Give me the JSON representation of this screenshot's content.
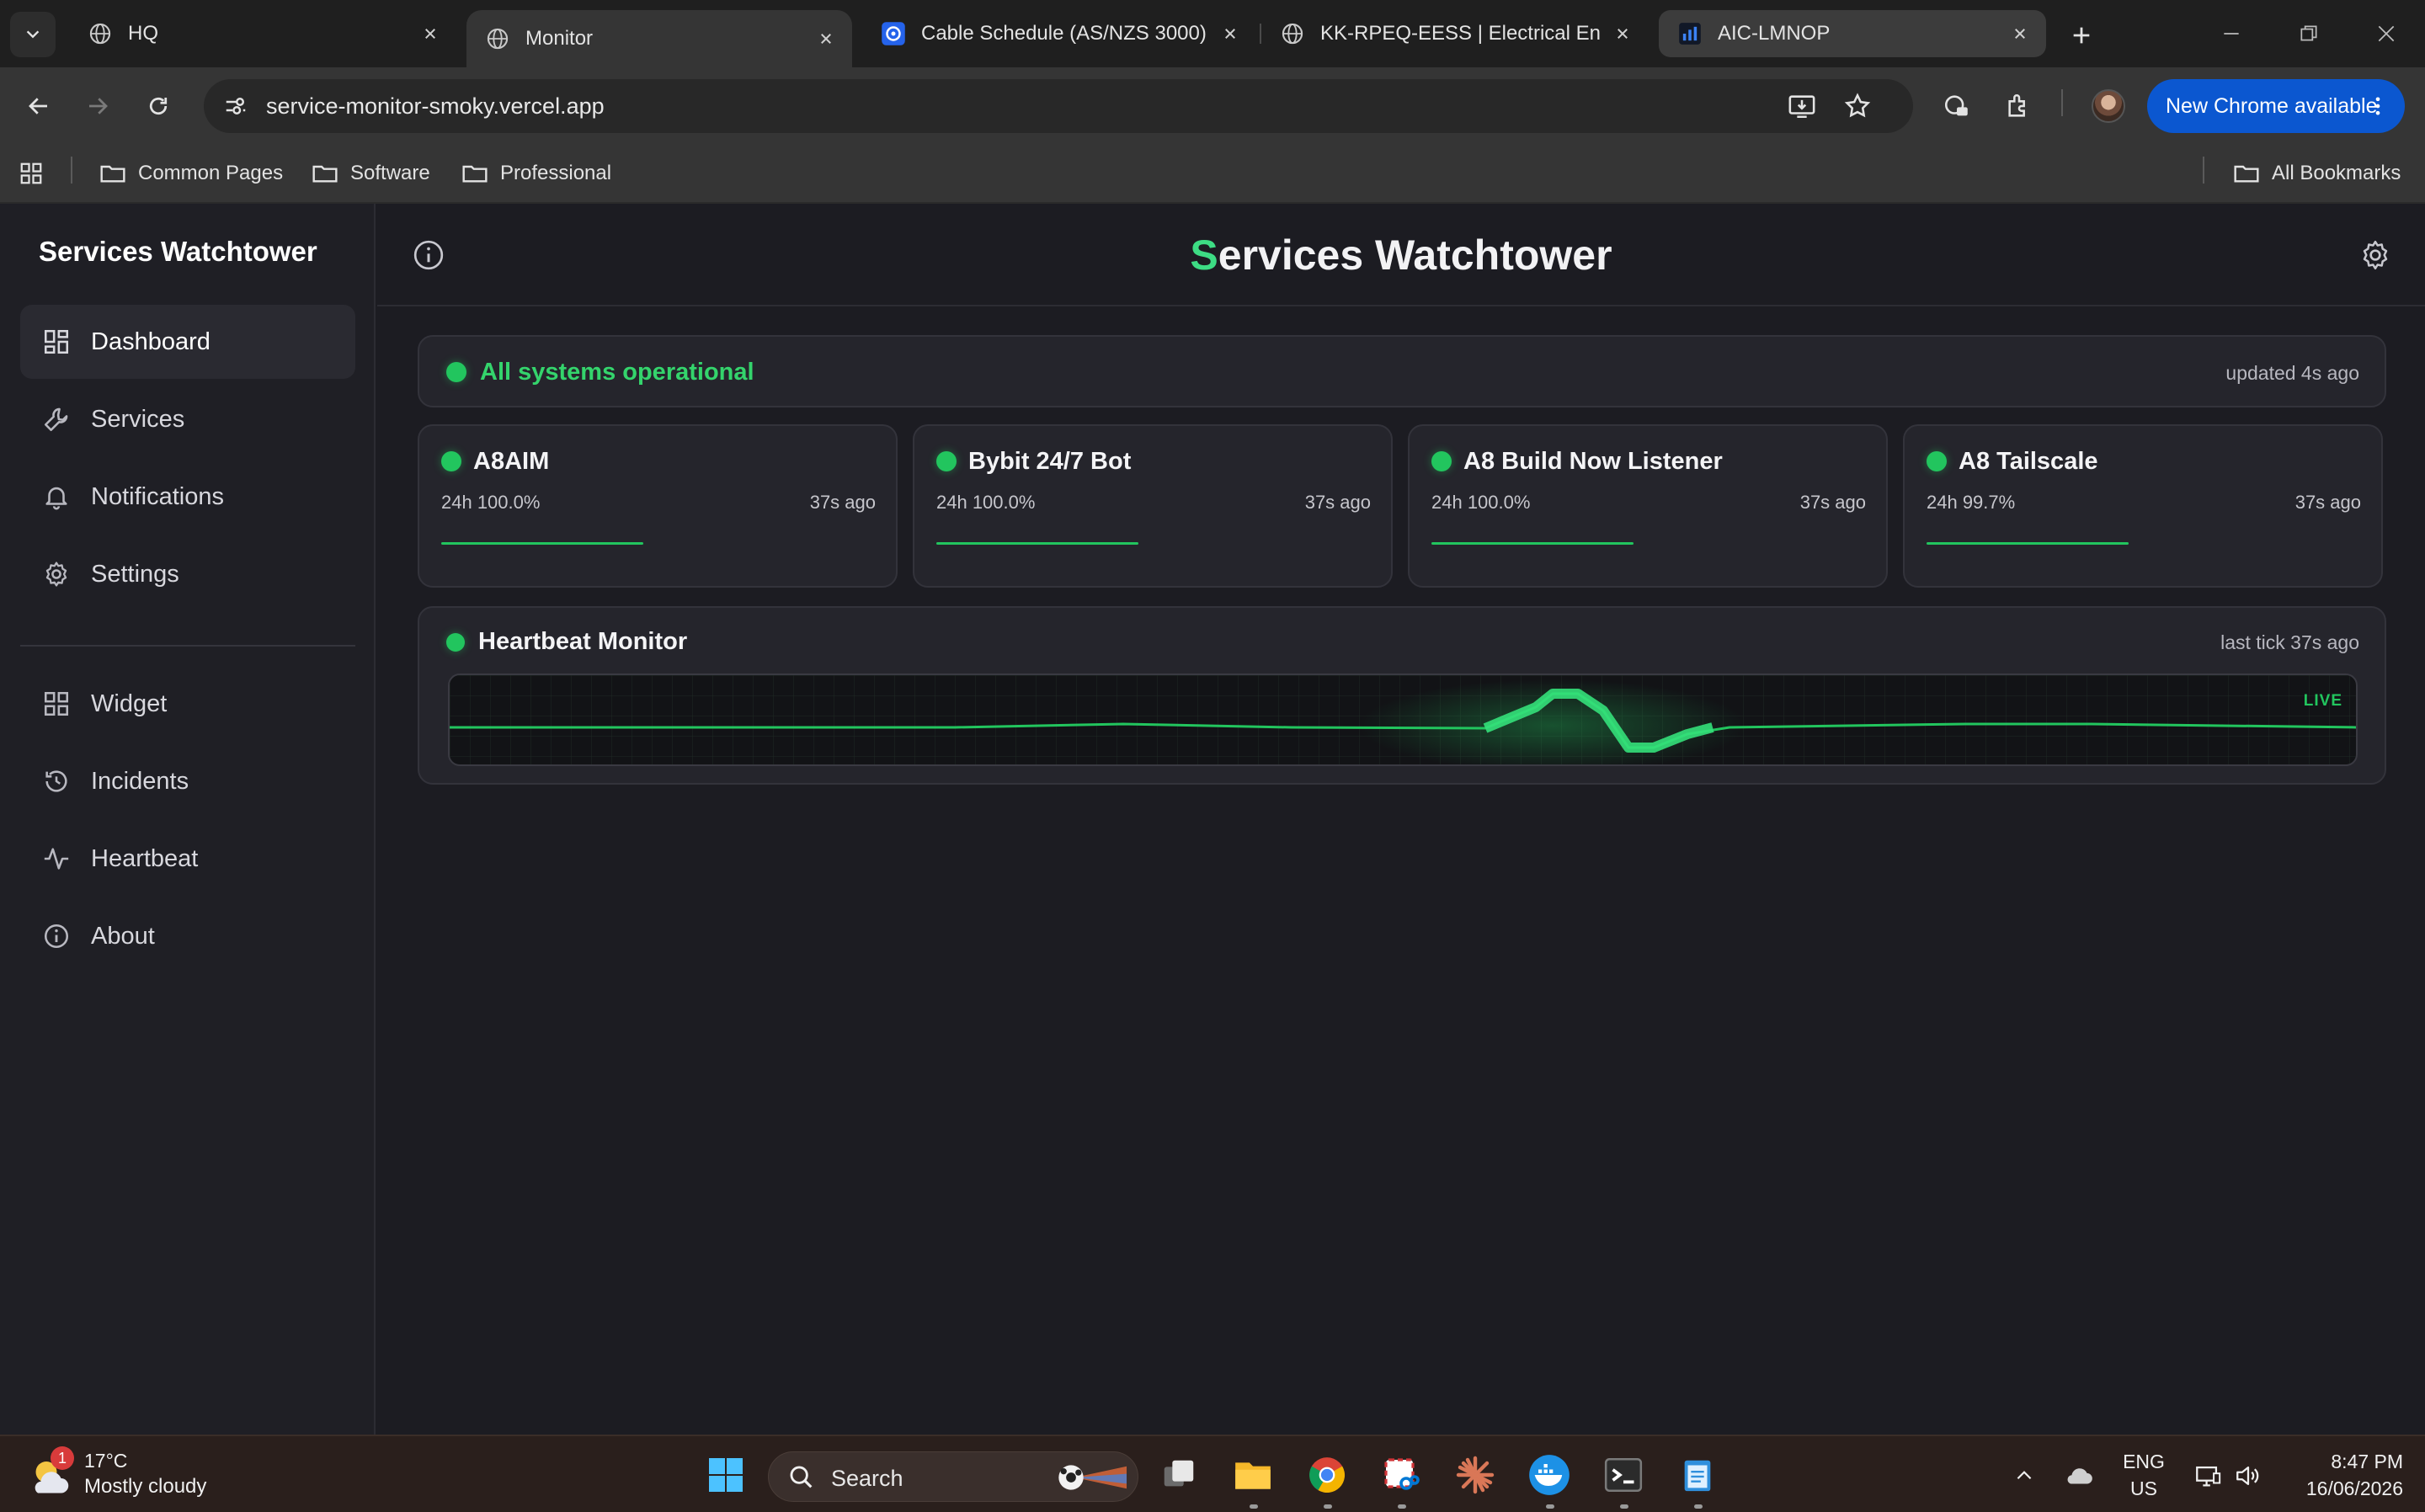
{
  "browser": {
    "tabs": [
      {
        "title": "HQ",
        "favicon": "globe-icon"
      },
      {
        "title": "Monitor",
        "favicon": "globe-icon",
        "active": true
      },
      {
        "title": "Cable Schedule (AS/NZS 3000)",
        "favicon": "cable-app-icon"
      },
      {
        "title": "KK-RPEQ-EESS | Electrical Engineering",
        "favicon": "globe-icon"
      },
      {
        "title": "AIC-LMNOP",
        "favicon": "bar-chart-icon",
        "selected": true
      }
    ],
    "url": "service-monitor-smoky.vercel.app",
    "update_button": "New Chrome available",
    "bookmarks": [
      "Common Pages",
      "Software",
      "Professional"
    ],
    "all_bookmarks": "All Bookmarks"
  },
  "app": {
    "sidebar_title": "Services Watchtower",
    "nav_primary": [
      {
        "label": "Dashboard",
        "icon": "dashboard-icon",
        "active": true
      },
      {
        "label": "Services",
        "icon": "wrench-icon"
      },
      {
        "label": "Notifications",
        "icon": "bell-icon"
      },
      {
        "label": "Settings",
        "icon": "gear-icon"
      }
    ],
    "nav_secondary": [
      {
        "label": "Widget",
        "icon": "widget-icon"
      },
      {
        "label": "Incidents",
        "icon": "history-icon"
      },
      {
        "label": "Heartbeat",
        "icon": "pulse-icon"
      },
      {
        "label": "About",
        "icon": "info-icon"
      }
    ],
    "header": {
      "title_first": "S",
      "title_rest": "ervices Watchtower"
    },
    "status": {
      "text": "All systems operational",
      "updated": "updated 4s ago",
      "color": "#22c55e"
    },
    "services": [
      {
        "name": "A8AIM",
        "uptime": "24h 100.0%",
        "ago": "37s ago"
      },
      {
        "name": "Bybit 24/7 Bot",
        "uptime": "24h 100.0%",
        "ago": "37s ago"
      },
      {
        "name": "A8 Build Now Listener",
        "uptime": "24h 100.0%",
        "ago": "37s ago"
      },
      {
        "name": "A8 Tailscale",
        "uptime": "24h 99.7%",
        "ago": "37s ago"
      }
    ],
    "heartbeat": {
      "title": "Heartbeat Monitor",
      "last_tick": "last tick 37s ago",
      "live_label": "LIVE"
    }
  },
  "taskbar": {
    "weather_temp": "17°C",
    "weather_desc": "Mostly cloudy",
    "weather_badge": "1",
    "search_placeholder": "Search",
    "lang_1": "ENG",
    "lang_2": "US",
    "time": "8:47 PM",
    "date": "16/06/2026"
  },
  "colors": {
    "accent": "#22c55e",
    "brand_blue": "#0b57d0"
  }
}
